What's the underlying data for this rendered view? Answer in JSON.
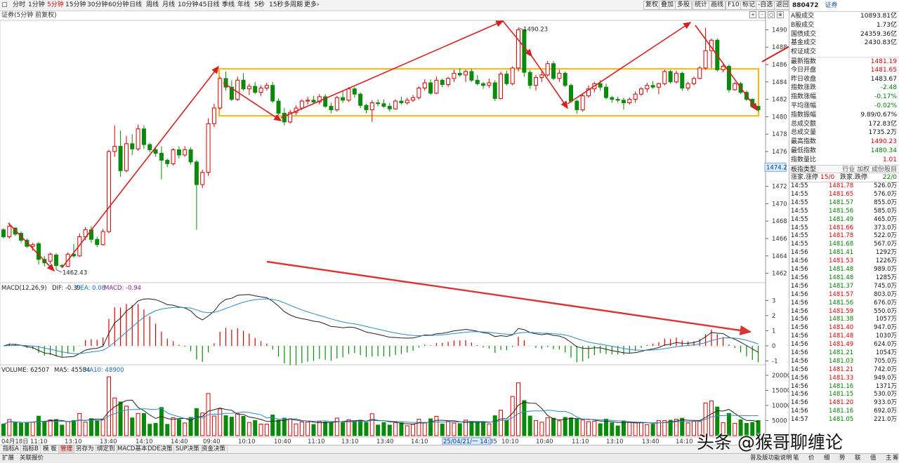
{
  "toolbar": {
    "periods": [
      "分时",
      "1分钟",
      "5分钟",
      "15分钟",
      "30分钟",
      "60分钟",
      "日线",
      "周线",
      "月线",
      "10分钟",
      "45日线",
      "季线",
      "年线",
      "5秒",
      "15秒",
      "多周期",
      "更多"
    ],
    "active_period": "5分钟",
    "right_buttons": [
      "复权",
      "叠加",
      "多股",
      "统计",
      "画线",
      "F10",
      "标记",
      "-自选",
      "返回"
    ]
  },
  "chart_title": "证券(5分钟 前复权)",
  "controls": [
    "+",
    "-",
    "○",
    "⊗"
  ],
  "chart_data": {
    "type": "candlestick",
    "x_tick_labels": [
      "04月18日",
      "11:10",
      "13:10",
      "13:40",
      "14:10",
      "14:40",
      "09:40",
      "10:10",
      "10:40",
      "11:10",
      "13:10",
      "13:40",
      "14:10",
      "25/04/21/一 14:35",
      "10:10",
      "10:40",
      "11:10",
      "13:10",
      "13:40",
      "14:10"
    ],
    "price_axis": {
      "ylim": [
        1461,
        1491
      ],
      "ticks": [
        1462,
        1464,
        1466,
        1468,
        1470,
        1472,
        1474,
        1476,
        1478,
        1480,
        1482,
        1484,
        1486,
        1488,
        1490
      ],
      "cursor_label": "1474.2"
    },
    "annotations": {
      "low": "1462.43",
      "high": "1490.23"
    },
    "ohlc": [
      [
        1467.0,
        1467.2,
        1466.0,
        1466.2
      ],
      [
        1466.2,
        1467.8,
        1466.0,
        1467.4
      ],
      [
        1467.2,
        1467.3,
        1466.3,
        1466.5
      ],
      [
        1466.6,
        1466.8,
        1465.5,
        1465.8
      ],
      [
        1465.8,
        1466.0,
        1464.9,
        1465.1
      ],
      [
        1465.1,
        1465.5,
        1464.6,
        1465.3
      ],
      [
        1465.4,
        1465.6,
        1463.0,
        1463.6
      ],
      [
        1463.6,
        1464.0,
        1462.8,
        1463.2
      ],
      [
        1463.4,
        1464.4,
        1463.1,
        1464.2
      ],
      [
        1464.1,
        1464.3,
        1462.43,
        1462.9
      ],
      [
        1462.9,
        1463.1,
        1462.6,
        1462.8
      ],
      [
        1462.8,
        1464.4,
        1462.7,
        1464.2
      ],
      [
        1464.2,
        1465.4,
        1463.8,
        1464.0
      ],
      [
        1464.0,
        1466.6,
        1463.9,
        1466.2
      ],
      [
        1466.2,
        1467.3,
        1465.8,
        1467.0
      ],
      [
        1467.0,
        1467.4,
        1465.5,
        1465.9
      ],
      [
        1465.9,
        1466.2,
        1465.0,
        1465.3
      ],
      [
        1465.3,
        1467.1,
        1465.2,
        1466.8
      ],
      [
        1466.8,
        1476.2,
        1466.6,
        1476.0
      ],
      [
        1476.0,
        1479.0,
        1475.4,
        1476.6
      ],
      [
        1476.6,
        1478.4,
        1473.1,
        1473.8
      ],
      [
        1473.8,
        1477.8,
        1473.6,
        1476.9
      ],
      [
        1476.9,
        1478.0,
        1475.6,
        1476.3
      ],
      [
        1476.3,
        1479.1,
        1476.1,
        1478.6
      ],
      [
        1478.6,
        1479.0,
        1476.3,
        1476.8
      ],
      [
        1476.8,
        1477.0,
        1475.9,
        1476.2
      ],
      [
        1476.2,
        1476.4,
        1475.4,
        1475.8
      ],
      [
        1475.8,
        1476.6,
        1472.8,
        1475.0
      ],
      [
        1475.0,
        1475.2,
        1474.2,
        1474.6
      ],
      [
        1474.6,
        1476.4,
        1474.4,
        1476.2
      ],
      [
        1476.2,
        1476.6,
        1475.2,
        1475.6
      ],
      [
        1475.6,
        1476.6,
        1475.4,
        1476.2
      ],
      [
        1476.2,
        1476.5,
        1474.5,
        1474.8
      ],
      [
        1474.8,
        1475.0,
        1467.0,
        1472.2
      ],
      [
        1472.2,
        1473.9,
        1471.8,
        1473.6
      ],
      [
        1473.6,
        1479.8,
        1473.2,
        1479.2
      ],
      [
        1479.2,
        1481.5,
        1478.8,
        1481.0
      ],
      [
        1481.0,
        1484.6,
        1480.8,
        1484.4
      ],
      [
        1484.4,
        1485.2,
        1483.0,
        1483.4
      ],
      [
        1483.4,
        1484.2,
        1481.8,
        1482.0
      ],
      [
        1482.0,
        1484.6,
        1481.8,
        1484.2
      ],
      [
        1484.2,
        1485.0,
        1483.0,
        1483.2
      ],
      [
        1483.2,
        1483.8,
        1482.5,
        1483.5
      ],
      [
        1483.5,
        1484.0,
        1482.6,
        1482.8
      ],
      [
        1482.8,
        1483.6,
        1482.4,
        1483.3
      ],
      [
        1483.3,
        1483.9,
        1483.0,
        1483.6
      ],
      [
        1483.6,
        1484.0,
        1481.6,
        1481.8
      ],
      [
        1481.8,
        1482.1,
        1480.2,
        1480.4
      ],
      [
        1480.4,
        1481.0,
        1479.0,
        1479.4
      ],
      [
        1479.4,
        1480.8,
        1479.2,
        1480.5
      ],
      [
        1480.5,
        1481.3,
        1480.2,
        1481.0
      ],
      [
        1481.0,
        1482.0,
        1480.8,
        1481.8
      ],
      [
        1481.8,
        1482.3,
        1481.4,
        1481.9
      ],
      [
        1481.9,
        1482.4,
        1481.5,
        1481.7
      ],
      [
        1481.7,
        1482.6,
        1481.4,
        1482.3
      ],
      [
        1482.3,
        1482.6,
        1481.0,
        1481.2
      ],
      [
        1481.2,
        1481.6,
        1480.4,
        1480.8
      ],
      [
        1480.8,
        1482.4,
        1480.6,
        1482.2
      ],
      [
        1482.2,
        1483.0,
        1481.6,
        1481.9
      ],
      [
        1481.9,
        1483.4,
        1481.7,
        1483.2
      ],
      [
        1483.2,
        1483.4,
        1482.2,
        1482.6
      ],
      [
        1482.6,
        1482.8,
        1481.0,
        1481.3
      ],
      [
        1481.3,
        1481.5,
        1480.4,
        1480.8
      ],
      [
        1480.8,
        1481.9,
        1479.4,
        1481.6
      ],
      [
        1481.6,
        1482.0,
        1481.2,
        1481.5
      ],
      [
        1481.5,
        1482.0,
        1481.0,
        1481.2
      ],
      [
        1481.2,
        1481.6,
        1480.6,
        1480.9
      ],
      [
        1480.9,
        1482.0,
        1480.8,
        1481.8
      ],
      [
        1481.8,
        1482.3,
        1481.4,
        1481.6
      ],
      [
        1481.6,
        1482.2,
        1481.4,
        1481.9
      ],
      [
        1481.9,
        1482.5,
        1481.7,
        1482.2
      ],
      [
        1482.2,
        1483.5,
        1482.0,
        1483.3
      ],
      [
        1483.3,
        1484.3,
        1483.0,
        1483.9
      ],
      [
        1483.9,
        1484.3,
        1482.5,
        1482.7
      ],
      [
        1482.7,
        1484.6,
        1482.6,
        1484.2
      ],
      [
        1484.2,
        1484.4,
        1483.4,
        1483.7
      ],
      [
        1483.7,
        1484.6,
        1483.4,
        1484.4
      ],
      [
        1484.4,
        1485.4,
        1484.0,
        1485.0
      ],
      [
        1485.0,
        1485.6,
        1484.6,
        1484.8
      ],
      [
        1484.8,
        1485.4,
        1484.0,
        1485.2
      ],
      [
        1485.2,
        1485.5,
        1484.0,
        1484.2
      ],
      [
        1484.2,
        1484.8,
        1483.6,
        1483.8
      ],
      [
        1483.8,
        1484.0,
        1483.2,
        1483.6
      ],
      [
        1483.6,
        1484.4,
        1483.3,
        1483.9
      ],
      [
        1483.9,
        1484.2,
        1481.8,
        1482.1
      ],
      [
        1482.1,
        1485.2,
        1482.0,
        1484.9
      ],
      [
        1484.9,
        1485.3,
        1483.6,
        1483.8
      ],
      [
        1483.8,
        1485.8,
        1483.6,
        1485.6
      ],
      [
        1485.6,
        1490.23,
        1485.2,
        1490.0
      ],
      [
        1490.0,
        1490.1,
        1484.6,
        1485.1
      ],
      [
        1485.1,
        1485.4,
        1483.2,
        1483.6
      ],
      [
        1483.6,
        1484.8,
        1483.0,
        1484.5
      ],
      [
        1484.5,
        1485.2,
        1484.0,
        1484.8
      ],
      [
        1484.8,
        1486.4,
        1484.6,
        1486.1
      ],
      [
        1486.1,
        1486.4,
        1484.2,
        1484.4
      ],
      [
        1484.4,
        1485.4,
        1484.0,
        1485.0
      ],
      [
        1485.0,
        1485.2,
        1483.4,
        1483.6
      ],
      [
        1483.6,
        1483.8,
        1481.6,
        1481.8
      ],
      [
        1481.8,
        1482.0,
        1480.34,
        1480.8
      ],
      [
        1480.8,
        1482.6,
        1480.6,
        1482.4
      ],
      [
        1482.4,
        1483.6,
        1482.2,
        1483.2
      ],
      [
        1483.2,
        1484.0,
        1482.8,
        1483.8
      ],
      [
        1483.8,
        1484.2,
        1483.0,
        1483.4
      ],
      [
        1483.4,
        1483.8,
        1482.0,
        1482.2
      ],
      [
        1482.2,
        1482.4,
        1481.6,
        1482.0
      ],
      [
        1482.0,
        1482.3,
        1481.6,
        1481.9
      ],
      [
        1481.9,
        1482.2,
        1480.8,
        1481.6
      ],
      [
        1481.6,
        1482.2,
        1481.4,
        1482.0
      ],
      [
        1482.0,
        1482.9,
        1481.6,
        1482.6
      ],
      [
        1482.6,
        1483.4,
        1482.4,
        1483.2
      ],
      [
        1483.2,
        1483.9,
        1482.8,
        1483.6
      ],
      [
        1483.6,
        1484.1,
        1483.2,
        1483.4
      ],
      [
        1483.4,
        1483.9,
        1482.6,
        1483.8
      ],
      [
        1483.8,
        1485.4,
        1483.6,
        1485.2
      ],
      [
        1485.2,
        1485.4,
        1483.8,
        1484.0
      ],
      [
        1484.0,
        1485.3,
        1483.8,
        1485.0
      ],
      [
        1485.0,
        1485.2,
        1483.0,
        1483.3
      ],
      [
        1483.3,
        1484.0,
        1483.0,
        1483.8
      ],
      [
        1483.8,
        1484.6,
        1483.6,
        1484.4
      ],
      [
        1484.4,
        1485.8,
        1484.3,
        1485.6
      ],
      [
        1485.6,
        1490.23,
        1485.4,
        1487.6
      ],
      [
        1487.6,
        1489.0,
        1485.6,
        1488.8
      ],
      [
        1488.8,
        1489.0,
        1485.2,
        1485.4
      ],
      [
        1485.4,
        1486.0,
        1485.1,
        1485.8
      ],
      [
        1485.8,
        1486.0,
        1482.8,
        1483.1
      ],
      [
        1483.1,
        1484.0,
        1483.0,
        1483.8
      ],
      [
        1483.8,
        1484.0,
        1482.6,
        1482.8
      ],
      [
        1482.8,
        1483.0,
        1481.8,
        1482.0
      ],
      [
        1482.0,
        1482.1,
        1481.0,
        1481.2
      ],
      [
        1481.2,
        1481.3,
        1480.6,
        1480.8
      ]
    ],
    "macd": {
      "label": "MACD(12,26,9)",
      "dif_label": "DIF: -0.39",
      "dea_label": "DEA: 0.08",
      "macd_label": "MACD: -0.94",
      "ticks": [
        -1.0,
        0.0,
        1.0,
        2.0,
        3.0
      ]
    },
    "volume": {
      "label": "VOLUME: 62507",
      "ma5_label": "MA5: 45584",
      "ma10_label": "MA10: 48900",
      "ticks": [
        5000,
        10000,
        15000,
        20000
      ]
    }
  },
  "right_panel": {
    "code": "880472",
    "name": "证券",
    "stats": [
      {
        "k": "A股成交",
        "v": "10893.81亿",
        "c": "blk"
      },
      {
        "k": "B股成交",
        "v": "1.73亿",
        "c": "blk"
      },
      {
        "k": "国债成交",
        "v": "24359.36亿",
        "c": "blk"
      },
      {
        "k": "基金成交",
        "v": "2430.83亿",
        "c": "blk"
      },
      {
        "k": "权证成交",
        "v": "",
        "c": "blk"
      },
      {
        "k": "最新指数",
        "v": "1481.19",
        "c": "red"
      },
      {
        "k": "今日开盘",
        "v": "1481.65",
        "c": "red"
      },
      {
        "k": "昨日收盘",
        "v": "1483.67",
        "c": "blk"
      },
      {
        "k": "指数涨跌",
        "v": "-2.48",
        "c": "grn"
      },
      {
        "k": "指数涨幅",
        "v": "-0.17%",
        "c": "grn"
      },
      {
        "k": "平均涨幅",
        "v": "-0.02%",
        "c": "grn"
      },
      {
        "k": "指数振幅",
        "v": "9.89/0.67%",
        "c": "blk"
      },
      {
        "k": "总成交额",
        "v": "172.83亿",
        "c": "blk"
      },
      {
        "k": "总成交量",
        "v": "1735.2万",
        "c": "blk"
      },
      {
        "k": "最高指数",
        "v": "1490.23",
        "c": "red"
      },
      {
        "k": "最低指数",
        "v": "1480.34",
        "c": "grn"
      },
      {
        "k": "指数量比",
        "v": "1.01",
        "c": "red"
      }
    ],
    "type_row": {
      "k": "板指类型",
      "v": "行业 加权 成份股目"
    },
    "breadth": {
      "k1": "涨家.涨停",
      "v1": "15/0",
      "k2": "跌家.跌停",
      "v2": "22/0"
    },
    "ticks": [
      [
        "14:55",
        "1481.78",
        "526.0万",
        "r"
      ],
      [
        "14:55",
        "1481.65",
        "576.0万",
        "r"
      ],
      [
        "14:55",
        "1481.57",
        "855.0万",
        "g"
      ],
      [
        "14:55",
        "1481.56",
        "585.0万",
        "g"
      ],
      [
        "14:55",
        "1481.49",
        "465.0万",
        "g"
      ],
      [
        "14:55",
        "1481.66",
        "373.0万",
        "r"
      ],
      [
        "14:55",
        "1481.78",
        "522.0万",
        "r"
      ],
      [
        "14:55",
        "1481.68",
        "567.0万",
        "g"
      ],
      [
        "14:56",
        "1481.41",
        "1292万",
        "g"
      ],
      [
        "14:56",
        "1481.53",
        "1226万",
        "r"
      ],
      [
        "14:56",
        "1481.48",
        "989.0万",
        "g"
      ],
      [
        "14:56",
        "1481.48",
        "1285万",
        "g"
      ],
      [
        "14:56",
        "1481.37",
        "745.0万",
        "g"
      ],
      [
        "14:56",
        "1481.57",
        "803.0万",
        "r"
      ],
      [
        "14:56",
        "1481.56",
        "676.0万",
        "g"
      ],
      [
        "14:56",
        "1481.59",
        "550.0万",
        "r"
      ],
      [
        "14:56",
        "1481.38",
        "1057万",
        "g"
      ],
      [
        "14:56",
        "1481.40",
        "947.0万",
        "r"
      ],
      [
        "14:56",
        "1481.48",
        "1030万",
        "r"
      ],
      [
        "14:56",
        "1481.49",
        "624.0万",
        "r"
      ],
      [
        "14:56",
        "1481.21",
        "1054万",
        "g"
      ],
      [
        "14:56",
        "1481.03",
        "705.0万",
        "g"
      ],
      [
        "14:56",
        "1481.21",
        "742.0万",
        "r"
      ],
      [
        "14:56",
        "1481.33",
        "949.0万",
        "r"
      ],
      [
        "14:56",
        "1481.16",
        "1371万",
        "g"
      ],
      [
        "14:56",
        "1481.15",
        "530.0万",
        "g"
      ],
      [
        "14:56",
        "1481.20",
        "933.0万",
        "r"
      ],
      [
        "14:56",
        "1481.16",
        "692.0万",
        "g"
      ],
      [
        "14:57",
        "1481.05",
        "221.0万",
        "g"
      ]
    ]
  },
  "bottom_tabs": [
    "指标A",
    "指标B",
    "模 板",
    "管理",
    "另存为",
    "绑定到",
    "MACD基本",
    "DDE决策",
    "SUP决策",
    "资金决策"
  ],
  "active_tab": "管理",
  "status_left": [
    "扩展",
    "关联报价"
  ],
  "status_right": [
    "普及版功能说明",
    "笔",
    "价",
    "细",
    "势",
    "联",
    "值",
    "主",
    "筹"
  ],
  "watermark": "头条 @猴哥聊缠论"
}
